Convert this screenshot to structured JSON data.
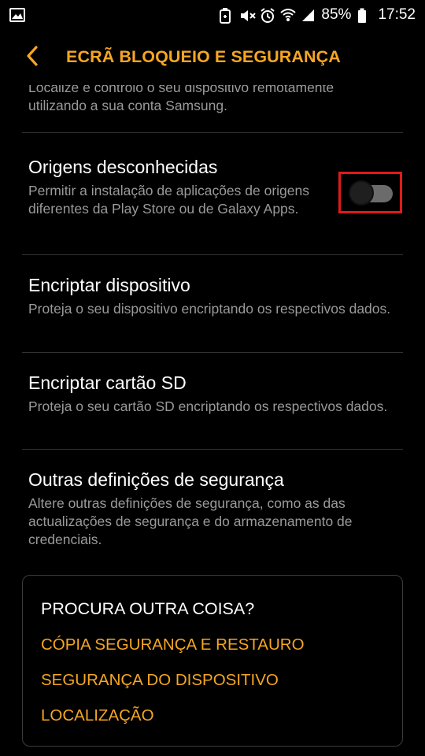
{
  "status_bar": {
    "battery_percent": "85%",
    "time": "17:52",
    "icons": [
      "image-icon",
      "battery-saver-icon",
      "mute-icon",
      "alarm-icon",
      "wifi-icon",
      "signal-icon",
      "battery-icon"
    ]
  },
  "app_bar": {
    "title": "ECRÃ BLOQUEIO E SEGURANÇA",
    "back_icon": "chevron-left-icon",
    "accent_color": "#f5a623"
  },
  "list": {
    "partial_item_text": "Localize e controlo o seu dispositivo remotamente utilizando a sua conta Samsung.",
    "items": [
      {
        "title": "Origens desconhecidas",
        "subtitle": "Permitir a instalação de aplicações de origens diferentes da Play Store ou de Galaxy Apps.",
        "toggle_state": "off"
      },
      {
        "title": "Encriptar dispositivo",
        "subtitle": "Proteja o seu dispositivo encriptando os respectivos dados."
      },
      {
        "title": "Encriptar cartão SD",
        "subtitle": "Proteja o seu cartão SD encriptando os respectivos dados."
      },
      {
        "title": "Outras definições de segurança",
        "subtitle": "Altere outras definições de segurança, como as das actualizações de segurança e do armazenamento de credenciais."
      }
    ]
  },
  "search_card": {
    "title": "PROCURA OUTRA COISA?",
    "links": [
      "CÓPIA SEGURANÇA E RESTAURO",
      "SEGURANÇA DO DISPOSITIVO",
      "LOCALIZAÇÃO"
    ]
  }
}
